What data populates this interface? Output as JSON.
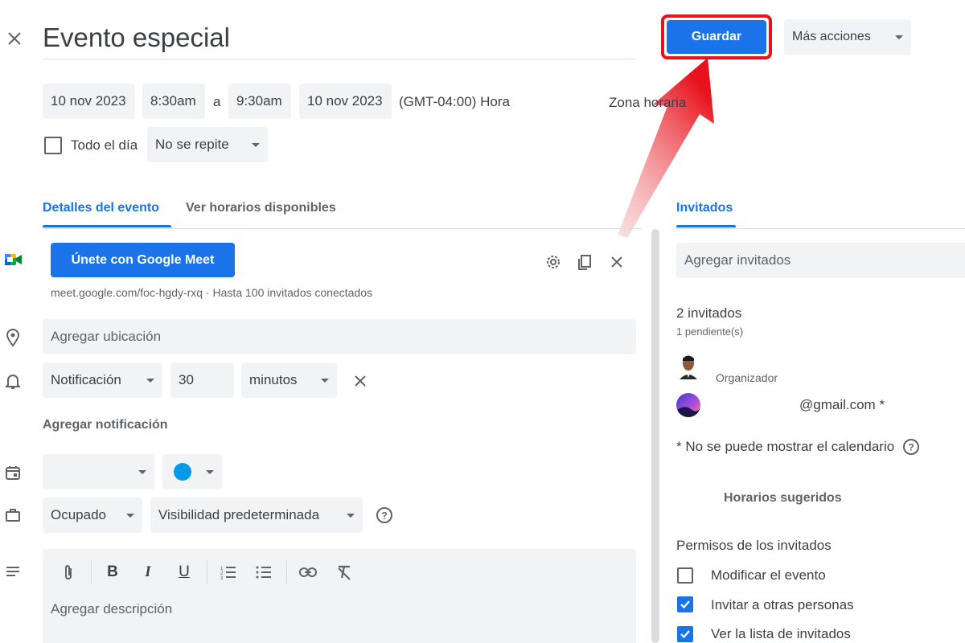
{
  "header": {
    "title": "Evento especial",
    "save_label": "Guardar",
    "more_actions_label": "Más acciones"
  },
  "datetime": {
    "start_date": "10 nov 2023",
    "start_time": "8:30am",
    "separator": "a",
    "end_time": "9:30am",
    "end_date": "10 nov 2023",
    "timezone": "(GMT-04:00) Hora",
    "timezone_link": "Zona horaria",
    "all_day_label": "Todo el día",
    "repeat_value": "No se repite"
  },
  "tabs": {
    "details": "Detalles del evento",
    "availability": "Ver horarios disponibles",
    "guests": "Invitados"
  },
  "meet": {
    "button_label": "Únete con Google Meet",
    "info": "meet.google.com/foc-hgdy-rxq · Hasta 100 invitados conectados"
  },
  "details": {
    "location_placeholder": "Agregar ubicación",
    "notification_type": "Notificación",
    "notification_amount": "30",
    "notification_unit": "minutos",
    "add_notification": "Agregar notificación",
    "calendar_value": "",
    "status_value": "Ocupado",
    "visibility_value": "Visibilidad predeterminada",
    "description_placeholder": "Agregar descripción"
  },
  "guests": {
    "add_placeholder": "Agregar invitados",
    "count": "2 invitados",
    "pending": "1 pendiente(s)",
    "organizer_label": "Organizador",
    "guest_email": "@gmail.com *",
    "calendar_note": "* No se puede mostrar el calendario",
    "suggested_times": "Horarios sugeridos",
    "permissions_title": "Permisos de los invitados",
    "permissions": [
      {
        "label": "Modificar el evento",
        "checked": false
      },
      {
        "label": "Invitar a otras personas",
        "checked": true
      },
      {
        "label": "Ver la lista de invitados",
        "checked": true
      }
    ]
  },
  "colors": {
    "accent": "#1a73e8",
    "highlight": "#e8121c",
    "event_color": "#039be5"
  },
  "icons": [
    "close-icon",
    "google-meet-icon",
    "gear-icon",
    "copy-icon",
    "location-pin-icon",
    "bell-icon",
    "calendar-icon",
    "briefcase-icon",
    "help-icon",
    "description-lines-icon",
    "paperclip-icon",
    "bold-icon",
    "italic-icon",
    "underline-icon",
    "numbered-list-icon",
    "bulleted-list-icon",
    "link-icon",
    "clear-format-icon"
  ]
}
